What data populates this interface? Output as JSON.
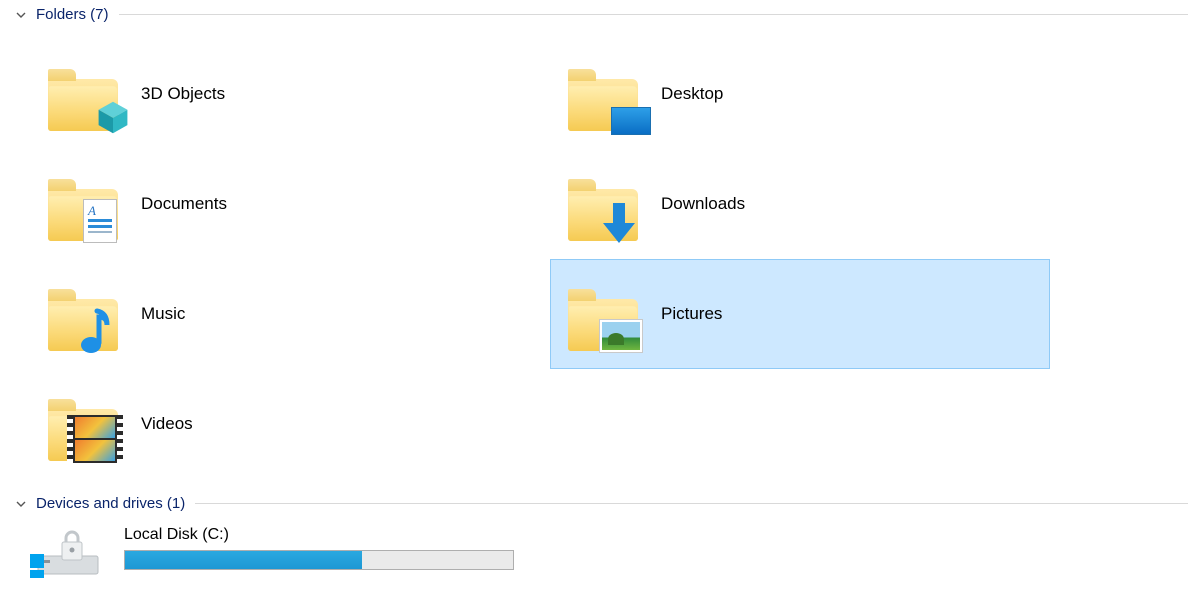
{
  "sections": {
    "folders": {
      "title": "Folders (7)"
    },
    "drives": {
      "title": "Devices and drives (1)"
    }
  },
  "folders": [
    {
      "name": "3D Objects",
      "icon": "3d-objects"
    },
    {
      "name": "Desktop",
      "icon": "desktop"
    },
    {
      "name": "Documents",
      "icon": "documents"
    },
    {
      "name": "Downloads",
      "icon": "downloads"
    },
    {
      "name": "Music",
      "icon": "music"
    },
    {
      "name": "Pictures",
      "icon": "pictures",
      "selected": true
    },
    {
      "name": "Videos",
      "icon": "videos"
    }
  ],
  "drives": [
    {
      "label": "Local Disk (C:)",
      "fill_percent": 61
    }
  ],
  "colors": {
    "selection_bg": "#cde8ff",
    "selection_border": "#8fcaf7",
    "header_text": "#0a246a",
    "capacity_fill": "#1d98d4"
  }
}
